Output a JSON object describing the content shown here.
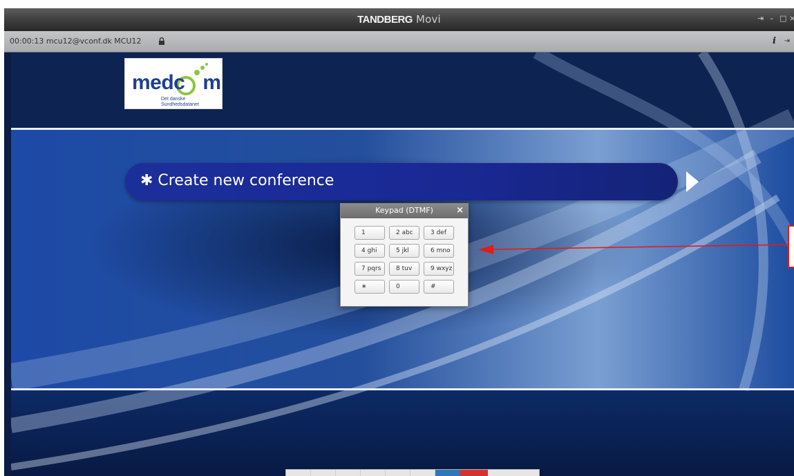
{
  "window": {
    "title_brand": "TANDBERG",
    "title_product": "Movi",
    "controls": {
      "pin": "⇥",
      "minimize": "–",
      "maximize": "□",
      "close": "×"
    }
  },
  "status": {
    "text": "00:00:13  mcu12@vconf.dk  MCU12",
    "info_label": "i",
    "pin_label": "⇥"
  },
  "content": {
    "logo_word_a": "medc",
    "logo_word_b": "m",
    "logo_sub_a": "Det danske",
    "logo_sub_b": "Sundhedsdatanet",
    "conference_label": "✱ Create new conference"
  },
  "keypad": {
    "title": "Keypad (DTMF)",
    "close": "×",
    "keys": [
      "1",
      "2  abc",
      "3  def",
      "4  ghi",
      "5  jkl",
      "6  mno",
      "7  pqrs",
      "8  tuv",
      "9  wxyz",
      "∗",
      "0",
      "#"
    ]
  },
  "toolbar": {
    "buttons": [
      "selfview",
      "camera",
      "microphone",
      "volume",
      "fullscreen",
      "layout",
      "keypad",
      "hangup"
    ]
  },
  "colors": {
    "accent_blue": "#2e78b8",
    "hangup_red": "#d63131",
    "annotation_red": "#e21b1b"
  }
}
